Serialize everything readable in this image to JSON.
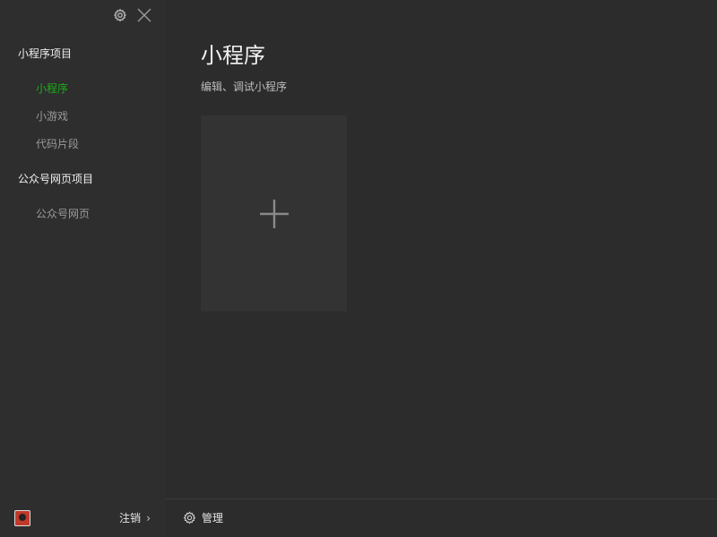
{
  "sidebar": {
    "groups": [
      {
        "title": "小程序项目",
        "items": [
          {
            "label": "小程序",
            "active": true
          },
          {
            "label": "小游戏",
            "active": false
          },
          {
            "label": "代码片段",
            "active": false
          }
        ]
      },
      {
        "title": "公众号网页项目",
        "items": [
          {
            "label": "公众号网页",
            "active": false
          }
        ]
      }
    ],
    "logout_label": "注销",
    "icons": {
      "settings": "gear-icon",
      "close": "close-icon",
      "logout_arrow": "chevron-right-icon"
    }
  },
  "main": {
    "title": "小程序",
    "subtitle": "编辑、调试小程序",
    "add_card_icon": "plus-icon"
  },
  "footer": {
    "manage_label": "管理",
    "manage_icon": "gear-icon"
  },
  "colors": {
    "accent": "#1aad19",
    "sidebar_bg": "#2e2e2e",
    "main_bg": "#2c2c2c",
    "card_bg": "#333333"
  }
}
